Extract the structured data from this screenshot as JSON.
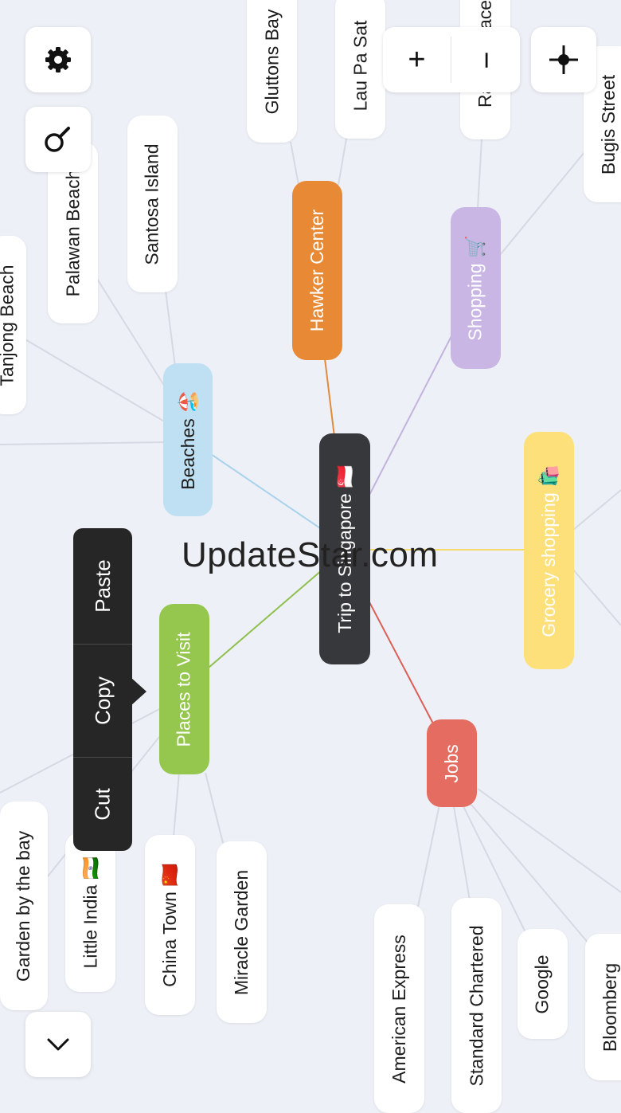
{
  "map": {
    "center": "Trip to Singapore 🇸🇬",
    "categories": {
      "beaches": "Beaches 🏖️",
      "hawker": "Hawker Center",
      "shopping": "Shopping 🛒",
      "grocery": "Grocery shopping 🛍️",
      "places": "Places to Visit",
      "jobs": "Jobs"
    },
    "leaves": {
      "tanjong": "Tanjong Beach",
      "palawan": "Palawan Beach",
      "santosa": "Santosa Island",
      "gluttons": "Gluttons Bay",
      "laupasat": "Lau Pa Sat",
      "raffles": "Raffles Place",
      "bugis": "Bugis Street",
      "garden": "Garden by the bay",
      "littleindia": "Little India 🇮🇳",
      "chinatown": "China Town 🇨🇳",
      "miracle": "Miracle Garden",
      "amex": "American Express",
      "stanchart": "Standard Chartered",
      "google": "Google",
      "bloomberg": "Bloomberg"
    }
  },
  "context_menu": {
    "cut": "Cut",
    "copy": "Copy",
    "paste": "Paste"
  },
  "controls": {
    "settings_icon": "gear-icon",
    "search_icon": "search-icon",
    "zoom_in": "+",
    "zoom_out": "−",
    "center_icon": "crosshair-icon",
    "collapse_icon": "chevron-down-icon"
  },
  "watermark": "UpdateStar.com",
  "colors": {
    "beaches": "#bfe0f2",
    "hawker": "#e88a35",
    "shopping": "#c9b6e4",
    "grocery": "#fde07a",
    "places": "#95c74f",
    "jobs": "#e46c60",
    "center": "#36383b"
  }
}
